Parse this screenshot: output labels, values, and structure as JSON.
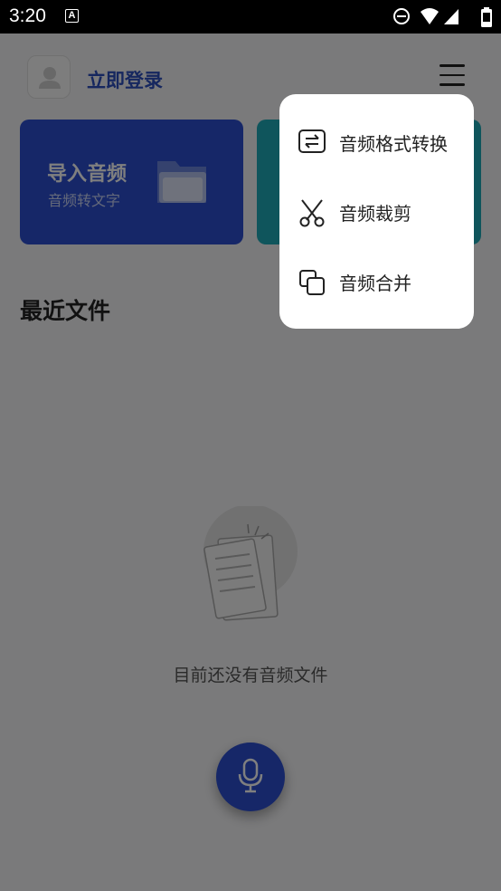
{
  "status_bar": {
    "time": "3:20",
    "notification_icon_letter": "A",
    "icons": [
      "do-not-disturb-icon",
      "wifi-icon",
      "signal-icon",
      "battery-icon"
    ]
  },
  "header": {
    "login_label": "立即登录",
    "avatar_icon": "user-icon",
    "menu_icon": "hamburger-menu-icon"
  },
  "cards": {
    "import": {
      "title": "导入音频",
      "subtitle": "音频转文字",
      "icon": "folder-icon"
    }
  },
  "recent": {
    "title": "最近文件"
  },
  "empty_state": {
    "text": "目前还没有音频文件",
    "icon": "documents-icon"
  },
  "record_button": {
    "icon": "microphone-icon"
  },
  "popup_menu": {
    "items": [
      {
        "label": "音频格式转换",
        "icon": "format-convert-icon"
      },
      {
        "label": "音频裁剪",
        "icon": "scissors-icon"
      },
      {
        "label": "音频合并",
        "icon": "merge-icon"
      }
    ]
  },
  "colors": {
    "primary": "#2d4fd0",
    "accent_teal": "#1faab8",
    "login_text": "#2c4fbf",
    "overlay": "rgba(0,0,0,0.5)"
  }
}
